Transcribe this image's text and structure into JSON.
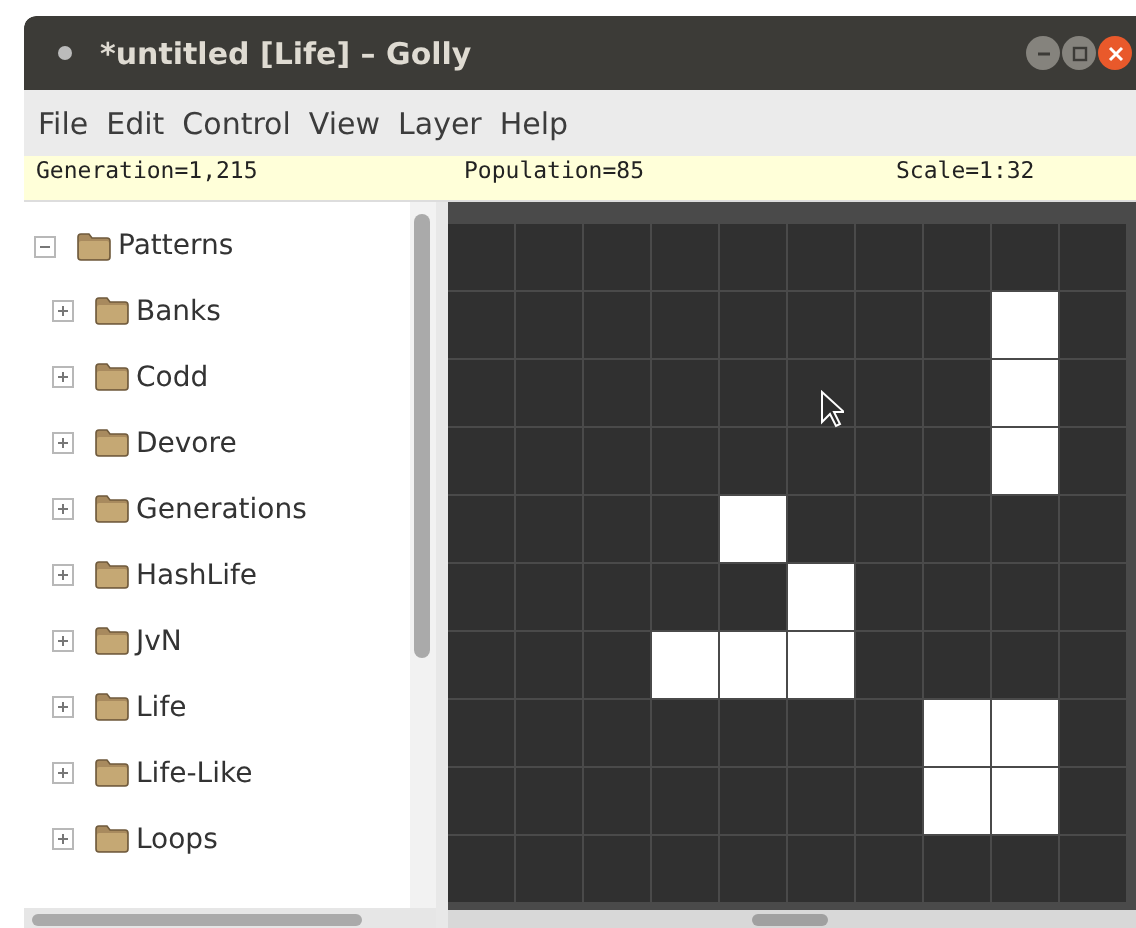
{
  "window": {
    "title": "*untitled [Life] – Golly"
  },
  "menu": [
    "File",
    "Edit",
    "Control",
    "View",
    "Layer",
    "Help"
  ],
  "status_bar": {
    "generation": "Generation=1,215",
    "population": "Population=85",
    "scale": "Scale=1:32"
  },
  "tree": {
    "label": "Patterns",
    "expanded": true,
    "children": [
      {
        "label": "Banks",
        "expanded": false
      },
      {
        "label": "Codd",
        "expanded": false
      },
      {
        "label": "Devore",
        "expanded": false
      },
      {
        "label": "Generations",
        "expanded": false
      },
      {
        "label": "HashLife",
        "expanded": false
      },
      {
        "label": "JvN",
        "expanded": false
      },
      {
        "label": "Life",
        "expanded": false
      },
      {
        "label": "Life-Like",
        "expanded": false
      },
      {
        "label": "Loops",
        "expanded": false
      }
    ]
  },
  "grid": {
    "rows": [
      [
        false,
        false,
        false,
        false,
        false,
        false,
        false,
        false,
        false,
        false
      ],
      [
        false,
        false,
        false,
        false,
        false,
        false,
        false,
        false,
        true,
        false
      ],
      [
        false,
        false,
        false,
        false,
        false,
        false,
        false,
        false,
        true,
        false
      ],
      [
        false,
        false,
        false,
        false,
        false,
        false,
        false,
        false,
        true,
        false
      ],
      [
        false,
        false,
        false,
        false,
        true,
        false,
        false,
        false,
        false,
        false
      ],
      [
        false,
        false,
        false,
        false,
        false,
        true,
        false,
        false,
        false,
        false
      ],
      [
        false,
        false,
        false,
        true,
        true,
        true,
        false,
        false,
        false,
        false
      ],
      [
        false,
        false,
        false,
        false,
        false,
        false,
        false,
        true,
        true,
        false
      ],
      [
        false,
        false,
        false,
        false,
        false,
        false,
        false,
        true,
        true,
        false
      ],
      [
        false,
        false,
        false,
        false,
        false,
        false,
        false,
        false,
        false,
        false
      ]
    ]
  }
}
